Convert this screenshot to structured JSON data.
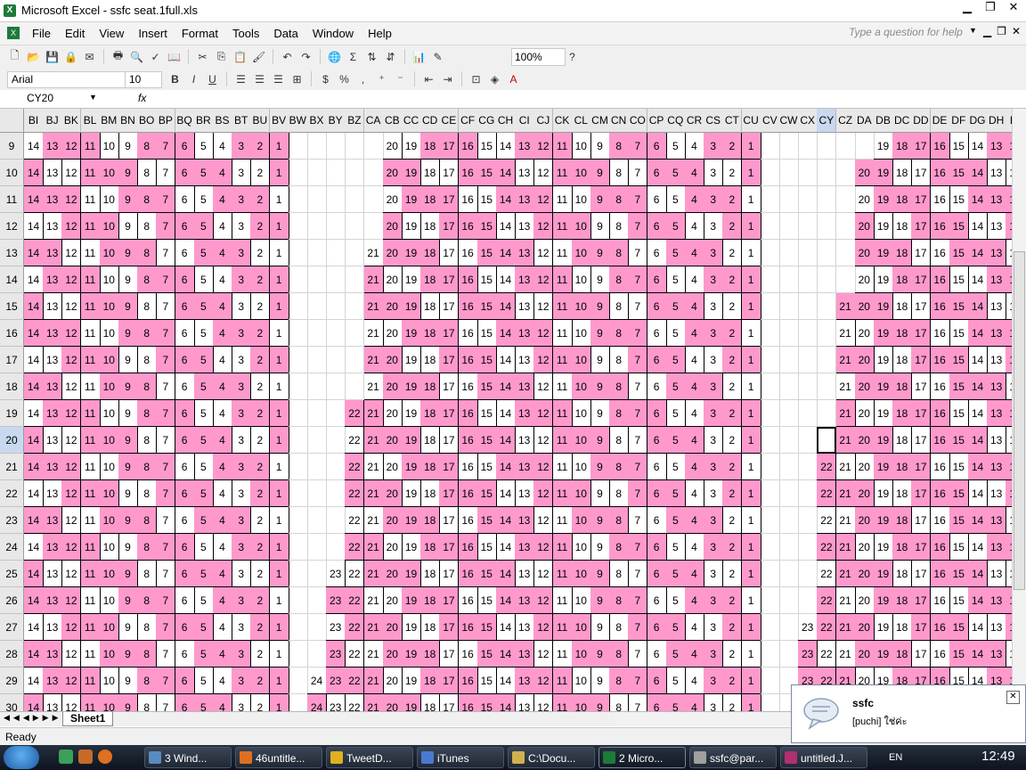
{
  "window": {
    "title": "Microsoft Excel - ssfc seat.1full.xls"
  },
  "menus": [
    "File",
    "Edit",
    "View",
    "Insert",
    "Format",
    "Tools",
    "Data",
    "Window",
    "Help"
  ],
  "help_placeholder": "Type a question for help",
  "toolbar": {
    "zoom": "100%",
    "font": "Arial",
    "font_size": "10",
    "bold": "B",
    "italic": "I",
    "underline": "U",
    "percent": "%",
    "comma": ",",
    "sigma": "Σ"
  },
  "formula": {
    "name_box": "CY20",
    "fx": "fx",
    "content": ""
  },
  "sheet": {
    "columns": [
      "BI",
      "BJ",
      "BK",
      "BL",
      "BM",
      "BN",
      "BO",
      "BP",
      "BQ",
      "BR",
      "BS",
      "BT",
      "BU",
      "BV",
      "BW",
      "BX",
      "BY",
      "BZ",
      "CA",
      "CB",
      "CC",
      "CD",
      "CE",
      "CF",
      "CG",
      "CH",
      "CI",
      "CJ",
      "CK",
      "CL",
      "CM",
      "CN",
      "CO",
      "CP",
      "CQ",
      "CR",
      "CS",
      "CT",
      "CU",
      "CV",
      "CW",
      "CX",
      "CY",
      "CZ",
      "DA",
      "DB",
      "DC",
      "DD",
      "DE",
      "DF",
      "DG",
      "DH",
      "DI"
    ],
    "rows": [
      "9",
      "10",
      "11",
      "12",
      "13",
      "14",
      "15",
      "16",
      "17",
      "18",
      "19",
      "20",
      "21",
      "22",
      "23",
      "24",
      "25",
      "26",
      "27",
      "28",
      "29",
      "30"
    ],
    "selected_column": "CY",
    "selected_row": "20",
    "tab": "Sheet1"
  },
  "status": "Ready",
  "notification": {
    "title": "ssfc",
    "message": "[puchi] ใช่ค่ะ"
  },
  "taskbar": {
    "tasks": [
      "3 Wind...",
      "46untitle...",
      "TweetD...",
      "iTunes",
      "C:\\Docu...",
      "2 Micro...",
      "ssfc@par...",
      "untitled.J..."
    ],
    "lang": "EN",
    "time": "12:49"
  },
  "colors": {
    "seat_pink": "#ff99cc",
    "grid": "#d4d4d4",
    "header": "#e8e8e8"
  }
}
